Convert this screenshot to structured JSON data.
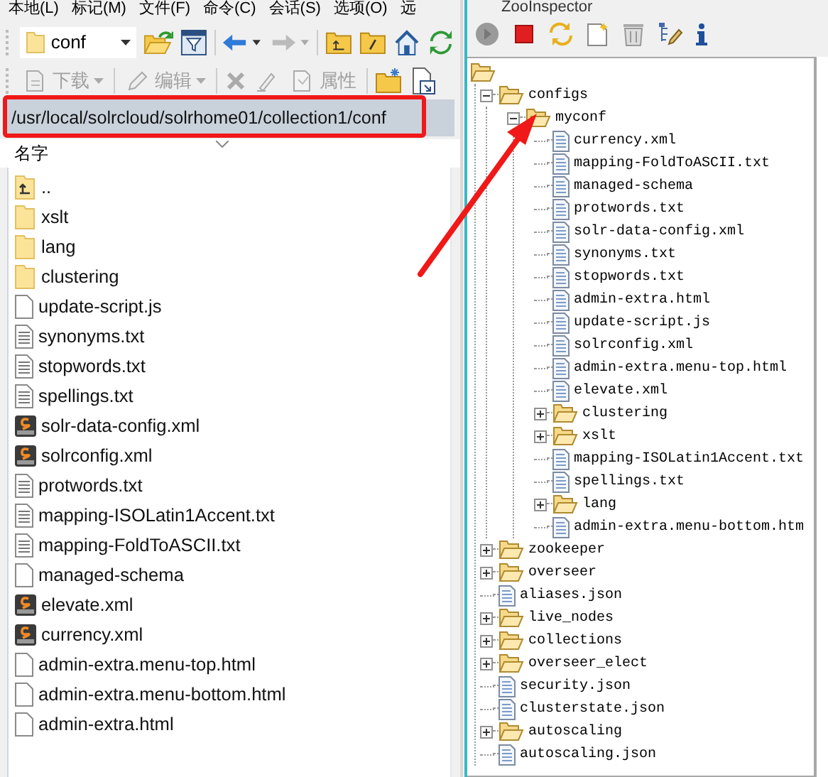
{
  "file_manager": {
    "menu": [
      "本地(L)",
      "标记(M)",
      "文件(F)",
      "命令(C)",
      "会话(S)",
      "选项(O)",
      "远"
    ],
    "location_combo": {
      "value": "conf"
    },
    "actions": [
      {
        "label": "下载",
        "disabled": true
      },
      {
        "label": "编辑",
        "disabled": true
      },
      {
        "label": "属性",
        "disabled": true
      }
    ],
    "path": "/usr/local/solrcloud/solrhome01/collection1/conf",
    "column_header": "名字",
    "files": [
      {
        "name": "..",
        "kind": "up"
      },
      {
        "name": "xslt",
        "kind": "folder"
      },
      {
        "name": "lang",
        "kind": "folder"
      },
      {
        "name": "clustering",
        "kind": "folder"
      },
      {
        "name": "update-script.js",
        "kind": "file"
      },
      {
        "name": "synonyms.txt",
        "kind": "text"
      },
      {
        "name": "stopwords.txt",
        "kind": "text"
      },
      {
        "name": "spellings.txt",
        "kind": "text"
      },
      {
        "name": "solr-data-config.xml",
        "kind": "solr"
      },
      {
        "name": "solrconfig.xml",
        "kind": "solr"
      },
      {
        "name": "protwords.txt",
        "kind": "text"
      },
      {
        "name": "mapping-ISOLatin1Accent.txt",
        "kind": "text"
      },
      {
        "name": "mapping-FoldToASCII.txt",
        "kind": "text"
      },
      {
        "name": "managed-schema",
        "kind": "file"
      },
      {
        "name": "elevate.xml",
        "kind": "solr"
      },
      {
        "name": "currency.xml",
        "kind": "solr"
      },
      {
        "name": "admin-extra.menu-top.html",
        "kind": "file"
      },
      {
        "name": "admin-extra.menu-bottom.html",
        "kind": "file"
      },
      {
        "name": "admin-extra.html",
        "kind": "file"
      }
    ]
  },
  "zooinspector": {
    "title": "ZooInspector",
    "tree": [
      {
        "name": "configs",
        "kind": "folder",
        "expanded": true,
        "children": [
          {
            "name": "myconf",
            "kind": "folder",
            "expanded": true,
            "children": [
              {
                "name": "currency.xml",
                "kind": "file"
              },
              {
                "name": "mapping-FoldToASCII.txt",
                "kind": "file"
              },
              {
                "name": "managed-schema",
                "kind": "file"
              },
              {
                "name": "protwords.txt",
                "kind": "file"
              },
              {
                "name": "solr-data-config.xml",
                "kind": "file"
              },
              {
                "name": "synonyms.txt",
                "kind": "file"
              },
              {
                "name": "stopwords.txt",
                "kind": "file"
              },
              {
                "name": "admin-extra.html",
                "kind": "file"
              },
              {
                "name": "update-script.js",
                "kind": "file"
              },
              {
                "name": "solrconfig.xml",
                "kind": "file"
              },
              {
                "name": "admin-extra.menu-top.html",
                "kind": "file"
              },
              {
                "name": "elevate.xml",
                "kind": "file"
              },
              {
                "name": "clustering",
                "kind": "folder",
                "expanded": false
              },
              {
                "name": "xslt",
                "kind": "folder",
                "expanded": false
              },
              {
                "name": "mapping-ISOLatin1Accent.txt",
                "kind": "file"
              },
              {
                "name": "spellings.txt",
                "kind": "file"
              },
              {
                "name": "lang",
                "kind": "folder",
                "expanded": false
              },
              {
                "name": "admin-extra.menu-bottom.htm",
                "kind": "file"
              }
            ]
          }
        ]
      },
      {
        "name": "zookeeper",
        "kind": "folder",
        "expanded": false
      },
      {
        "name": "overseer",
        "kind": "folder",
        "expanded": false
      },
      {
        "name": "aliases.json",
        "kind": "file"
      },
      {
        "name": "live_nodes",
        "kind": "folder",
        "expanded": false
      },
      {
        "name": "collections",
        "kind": "folder",
        "expanded": false
      },
      {
        "name": "overseer_elect",
        "kind": "folder",
        "expanded": false
      },
      {
        "name": "security.json",
        "kind": "file"
      },
      {
        "name": "clusterstate.json",
        "kind": "file"
      },
      {
        "name": "autoscaling",
        "kind": "folder",
        "expanded": false
      },
      {
        "name": "autoscaling.json",
        "kind": "file"
      }
    ]
  }
}
